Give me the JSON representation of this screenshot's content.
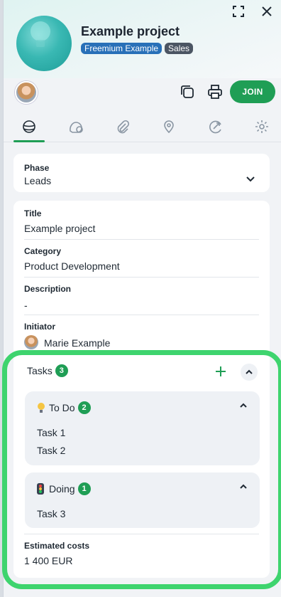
{
  "header": {
    "title": "Example project",
    "badges": [
      "Freemium Example",
      "Sales"
    ],
    "join_label": "JOIN"
  },
  "icons": {
    "fullscreen": "fullscreen-icon",
    "close": "close-icon",
    "copy": "copy-icon",
    "print": "print-icon"
  },
  "tabs": [
    "overview",
    "comments",
    "attachments",
    "location",
    "activity",
    "settings"
  ],
  "phase": {
    "label": "Phase",
    "value": "Leads"
  },
  "fields": {
    "title_label": "Title",
    "title_value": "Example project",
    "category_label": "Category",
    "category_value": "Product Development",
    "description_label": "Description",
    "description_value": "-",
    "initiator_label": "Initiator",
    "initiator_value": "Marie Example"
  },
  "tasks": {
    "label": "Tasks",
    "count": "3",
    "groups": [
      {
        "name": "To Do",
        "count": "2",
        "items": [
          "Task 1",
          "Task 2"
        ]
      },
      {
        "name": "Doing",
        "count": "1",
        "items": [
          "Task 3"
        ]
      }
    ]
  },
  "costs": {
    "label": "Estimated costs",
    "value": "1 400 EUR"
  },
  "colors": {
    "accent": "#1f9e55",
    "highlight": "#3ed46e",
    "badge_blue": "#2870b8",
    "badge_gray": "#4b5563"
  }
}
